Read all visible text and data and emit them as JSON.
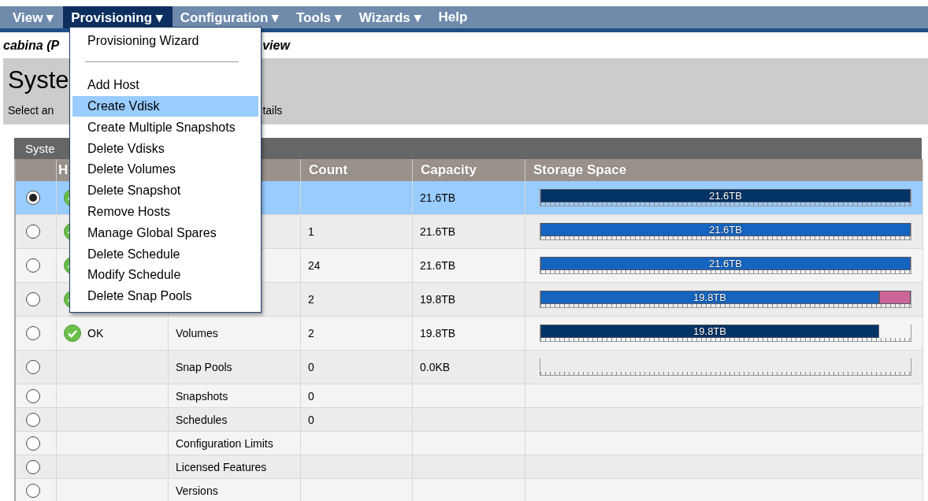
{
  "menu_bar": [
    {
      "label": "View ▾",
      "selected": false
    },
    {
      "label": "Provisioning ▾",
      "selected": true
    },
    {
      "label": "Configuration ▾",
      "selected": false
    },
    {
      "label": "Tools ▾",
      "selected": false
    },
    {
      "label": "Wizards ▾",
      "selected": false
    },
    {
      "label": "Help",
      "selected": false
    }
  ],
  "breadcrumb": {
    "before": "cabina (P",
    "after": "view"
  },
  "panel": {
    "title": "Syste",
    "hint_before": "Select an",
    "hint_after": "tails"
  },
  "dropdown": {
    "items": [
      {
        "kind": "item",
        "label": "Provisioning Wizard",
        "selected": false
      },
      {
        "kind": "separator"
      },
      {
        "kind": "item",
        "label": "Add Host",
        "selected": false
      },
      {
        "kind": "item",
        "label": "Create Vdisk",
        "selected": true
      },
      {
        "kind": "item",
        "label": "Create Multiple Snapshots",
        "selected": false
      },
      {
        "kind": "item",
        "label": "Delete Vdisks",
        "selected": false
      },
      {
        "kind": "item",
        "label": "Delete Volumes",
        "selected": false
      },
      {
        "kind": "item",
        "label": "Delete Snapshot",
        "selected": false
      },
      {
        "kind": "item",
        "label": "Remove Hosts",
        "selected": false
      },
      {
        "kind": "item",
        "label": "Manage Global Spares",
        "selected": false
      },
      {
        "kind": "item",
        "label": "Delete Schedule",
        "selected": false
      },
      {
        "kind": "item",
        "label": "Modify Schedule",
        "selected": false
      },
      {
        "kind": "item",
        "label": "Delete Snap Pools",
        "selected": false
      }
    ]
  },
  "table": {
    "title": "Syste",
    "columns": [
      "H",
      "Count",
      "Capacity",
      "Storage Space"
    ],
    "rows": [
      {
        "selected": true,
        "ok_icon": true,
        "count": "",
        "capacity": "21.6TB",
        "bar": {
          "label": "21.6TB",
          "segments": [
            {
              "level": 1,
              "color": "#003366"
            }
          ]
        }
      },
      {
        "selected": false,
        "ok_icon": true,
        "count": "1",
        "capacity": "21.6TB",
        "bar": {
          "label": "21.6TB",
          "segments": [
            {
              "level": 1,
              "color": "#1565c0"
            }
          ]
        }
      },
      {
        "selected": false,
        "ok_icon": true,
        "count": "24",
        "capacity": "21.6TB",
        "bar": {
          "label": "21.6TB",
          "segments": [
            {
              "level": 1,
              "color": "#1565c0"
            }
          ]
        }
      },
      {
        "selected": false,
        "ok_icon": true,
        "count": "2",
        "capacity": "19.8TB",
        "bar": {
          "label": "19.8TB",
          "segments": [
            {
              "level": 0.915,
              "color": "#1565c0"
            },
            {
              "level": 0.085,
              "color": "#cc6699"
            }
          ]
        }
      },
      {
        "selected": false,
        "ok_icon": true,
        "status_text": "OK",
        "component": "Volumes",
        "count": "2",
        "capacity": "19.8TB",
        "bar": {
          "label": "19.8TB",
          "segments": [
            {
              "level": 0.915,
              "color": "#003366"
            }
          ]
        }
      },
      {
        "selected": false,
        "ok_icon": false,
        "component": "Snap Pools",
        "count": "0",
        "capacity": "0.0KB",
        "bar": {}
      },
      {
        "selected": false,
        "ok_icon": false,
        "component": "Snapshots",
        "count": "0"
      },
      {
        "selected": false,
        "ok_icon": false,
        "component": "Schedules",
        "count": "0"
      },
      {
        "selected": false,
        "ok_icon": false,
        "component": "Configuration Limits"
      },
      {
        "selected": false,
        "ok_icon": false,
        "component": "Licensed Features"
      },
      {
        "selected": false,
        "ok_icon": false,
        "component": "Versions"
      }
    ]
  }
}
